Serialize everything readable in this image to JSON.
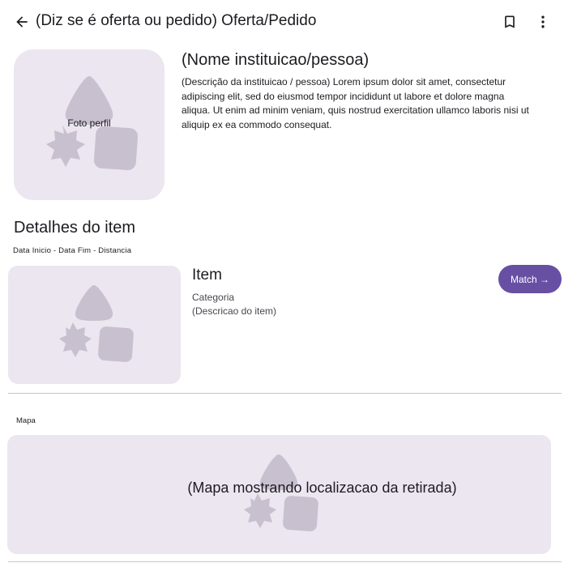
{
  "appbar": {
    "title": "(Diz se é oferta ou pedido) Oferta/Pedido",
    "icons": {
      "back": "arrow-back-icon",
      "bookmark": "bookmark-icon",
      "more": "more-vert-icon"
    }
  },
  "profile": {
    "image_caption": "Foto perfil",
    "name": "(Nome instituicao/pessoa)",
    "description": "(Descrição da instituicao / pessoa) Lorem ipsum dolor sit amet, consectetur adipiscing elit, sed do eiusmod tempor incididunt ut labore et dolore magna aliqua. Ut enim ad minim veniam, quis nostrud exercitation ullamco laboris nisi ut aliquip ex ea commodo consequat."
  },
  "details": {
    "section_title": "Detalhes do item",
    "meta": "Data Inicio - Data Fim - Distancia",
    "item": {
      "title": "Item",
      "category": "Categoria",
      "description": "(Descricao do item)",
      "match_label": "Match →"
    }
  },
  "map": {
    "label": "Mapa",
    "caption": "(Mapa mostrando localizacao da retirada)"
  },
  "colors": {
    "primary": "#6750a4",
    "placeholder_bg": "#ece6f0",
    "placeholder_shape": "#c9c0cf",
    "divider": "#cac4d0"
  }
}
